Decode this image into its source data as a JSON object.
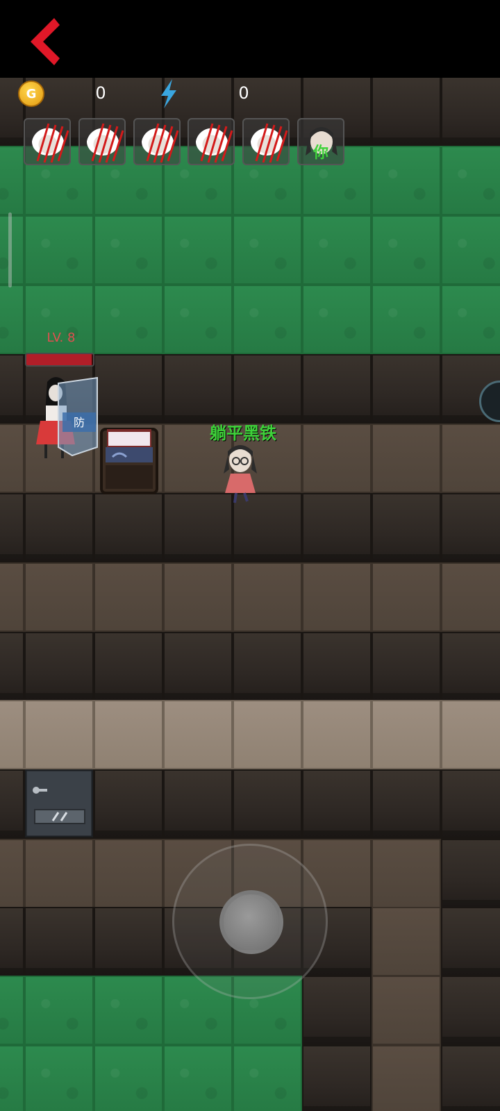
{
  "hud": {
    "coin_icon_label": "G",
    "coin_value": "0",
    "energy_value": "0"
  },
  "players": {
    "slots": [
      {
        "state": "eliminated"
      },
      {
        "state": "eliminated"
      },
      {
        "state": "eliminated"
      },
      {
        "state": "eliminated"
      },
      {
        "state": "eliminated"
      },
      {
        "state": "self",
        "label": "你"
      }
    ]
  },
  "enemy": {
    "level_label": "LV. 8",
    "hp_fraction": 0.98,
    "shield_label": "防"
  },
  "player": {
    "name": "躺平黑铁"
  },
  "colors": {
    "accent_red": "#e01828",
    "name_green": "#3ed23a",
    "grass": "#2d8a4e"
  },
  "icons": {
    "back": "chevron-left-icon",
    "coin": "coin-icon",
    "energy": "lightning-icon"
  }
}
